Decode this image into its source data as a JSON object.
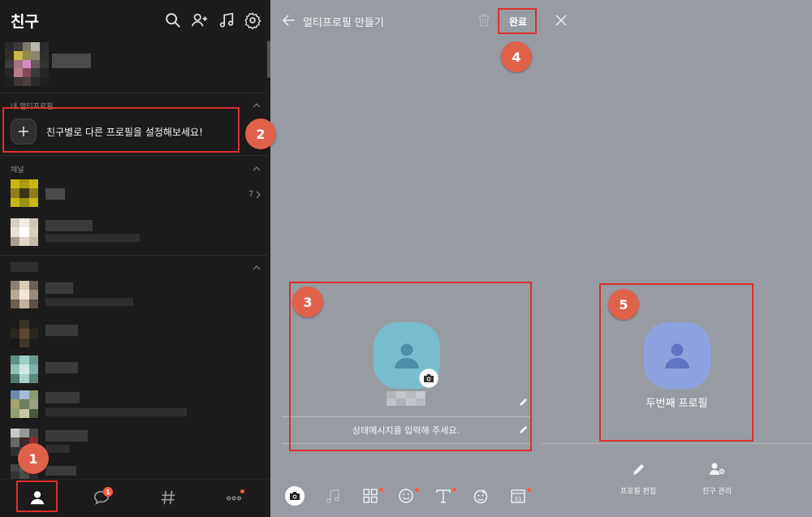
{
  "left": {
    "title": "친구",
    "my_multiprofile_label": "내 멀티프로필",
    "setup_text": "친구별로 다른 프로필을 설정해보세요!",
    "channel_label": "채널",
    "channel_count": "7",
    "tabbar": {
      "chat_badge": "1"
    },
    "icons": [
      "search-icon",
      "add-friend-icon",
      "music-icon",
      "settings-icon"
    ]
  },
  "middle": {
    "title": "멀티프로필 만들기",
    "done_label": "완료",
    "status_placeholder": "상태메시지를 입력해 주세요."
  },
  "right": {
    "profile_name": "두번째 프로필",
    "edit_label": "프로필 편집",
    "manage_label": "친구 관리"
  },
  "steps": [
    "1",
    "2",
    "3",
    "4",
    "5"
  ],
  "colors": {
    "highlight": "#e02e2e",
    "badge": "#e0614a",
    "avatar_teal": "#78bccd",
    "avatar_blue": "#8fa2e0"
  }
}
